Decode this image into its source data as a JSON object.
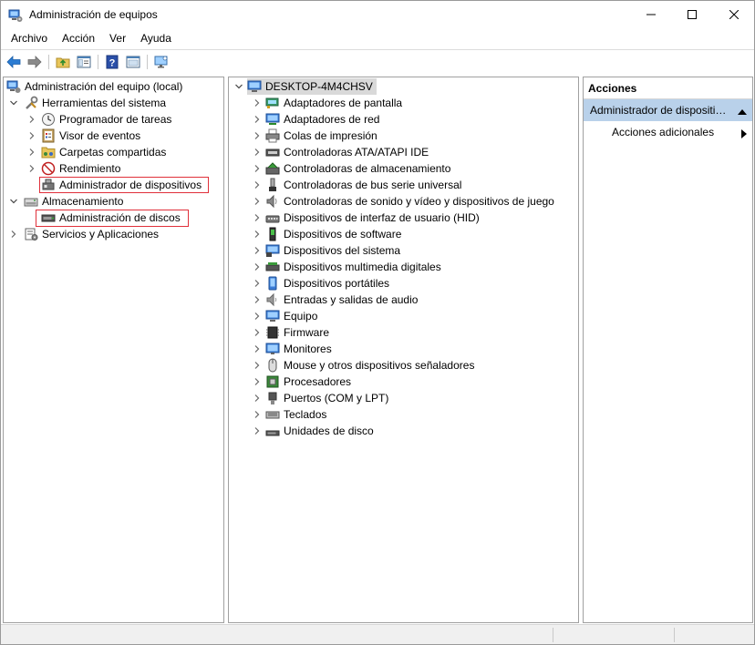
{
  "window": {
    "title": "Administración de equipos",
    "icon": "computer-management-icon"
  },
  "menu": [
    "Archivo",
    "Acción",
    "Ver",
    "Ayuda"
  ],
  "toolbar": {
    "buttons": [
      "back-icon",
      "forward-icon",
      "up-folder-icon",
      "show-hide-tree-icon",
      "help-icon",
      "properties-icon",
      "monitor-icon"
    ]
  },
  "left_tree": {
    "root": "Administración del equipo (local)",
    "system_tools": "Herramientas del sistema",
    "task_scheduler": "Programador de tareas",
    "event_viewer": "Visor de eventos",
    "shared_folders": "Carpetas compartidas",
    "performance": "Rendimiento",
    "device_manager": "Administrador de dispositivos",
    "storage": "Almacenamiento",
    "disk_management": "Administración de discos",
    "services_apps": "Servicios y Aplicaciones"
  },
  "device_tree": {
    "root": "DESKTOP-4M4CHSV",
    "categories": [
      {
        "label": "Adaptadores de pantalla",
        "icon": "display-adapter-icon"
      },
      {
        "label": "Adaptadores de red",
        "icon": "network-adapter-icon"
      },
      {
        "label": "Colas de impresión",
        "icon": "printer-icon"
      },
      {
        "label": "Controladoras ATA/ATAPI IDE",
        "icon": "ide-controller-icon"
      },
      {
        "label": "Controladoras de almacenamiento",
        "icon": "storage-controller-icon"
      },
      {
        "label": "Controladoras de bus serie universal",
        "icon": "usb-icon"
      },
      {
        "label": "Controladoras de sonido y vídeo y dispositivos de juego",
        "icon": "speaker-icon"
      },
      {
        "label": "Dispositivos de interfaz de usuario (HID)",
        "icon": "hid-icon"
      },
      {
        "label": "Dispositivos de software",
        "icon": "software-device-icon"
      },
      {
        "label": "Dispositivos del sistema",
        "icon": "system-device-icon"
      },
      {
        "label": "Dispositivos multimedia digitales",
        "icon": "multimedia-icon"
      },
      {
        "label": "Dispositivos portátiles",
        "icon": "portable-device-icon"
      },
      {
        "label": "Entradas y salidas de audio",
        "icon": "audio-io-icon"
      },
      {
        "label": "Equipo",
        "icon": "computer-icon"
      },
      {
        "label": "Firmware",
        "icon": "firmware-icon"
      },
      {
        "label": "Monitores",
        "icon": "monitor-icon"
      },
      {
        "label": "Mouse y otros dispositivos señaladores",
        "icon": "mouse-icon"
      },
      {
        "label": "Procesadores",
        "icon": "processor-icon"
      },
      {
        "label": "Puertos (COM y LPT)",
        "icon": "port-icon"
      },
      {
        "label": "Teclados",
        "icon": "keyboard-icon"
      },
      {
        "label": "Unidades de disco",
        "icon": "disk-drive-icon"
      }
    ]
  },
  "actions": {
    "header": "Acciones",
    "section": "Administrador de dispositivos",
    "more_actions": "Acciones adicionales"
  }
}
